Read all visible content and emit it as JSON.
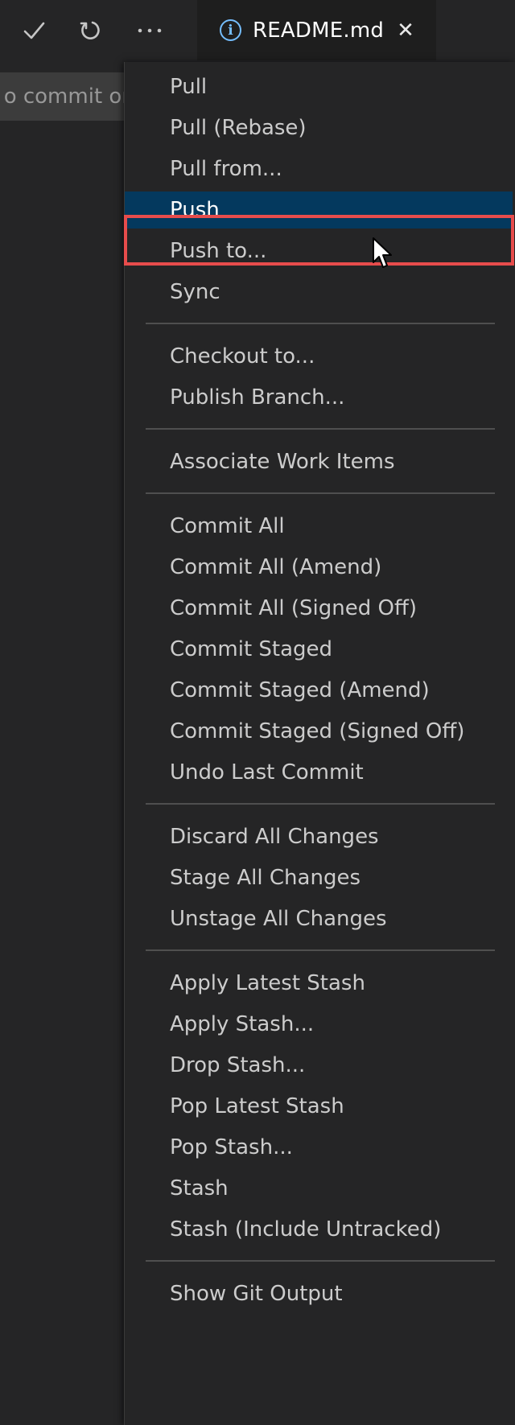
{
  "toolbar": {
    "commit_icon": "checkmark-icon",
    "refresh_icon": "refresh-icon",
    "more_icon": "ellipsis-icon",
    "more_label": "···"
  },
  "tab": {
    "icon": "info-icon",
    "icon_glyph": "i",
    "label": "README.md",
    "close_glyph": "✕"
  },
  "commit_input": {
    "text": "o commit or"
  },
  "menu": {
    "groups": [
      [
        "Pull",
        "Pull (Rebase)",
        "Pull from...",
        "Push",
        "Push to...",
        "Sync"
      ],
      [
        "Checkout to...",
        "Publish Branch..."
      ],
      [
        "Associate Work Items"
      ],
      [
        "Commit All",
        "Commit All (Amend)",
        "Commit All (Signed Off)",
        "Commit Staged",
        "Commit Staged (Amend)",
        "Commit Staged (Signed Off)",
        "Undo Last Commit"
      ],
      [
        "Discard All Changes",
        "Stage All Changes",
        "Unstage All Changes"
      ],
      [
        "Apply Latest Stash",
        "Apply Stash...",
        "Drop Stash...",
        "Pop Latest Stash",
        "Pop Stash...",
        "Stash",
        "Stash (Include Untracked)"
      ],
      [
        "Show Git Output"
      ]
    ],
    "active_item": "Push"
  },
  "colors": {
    "background": "#252526",
    "active_item": "#04395e",
    "highlight_border": "#e74c4c",
    "separator": "#4f4f4f",
    "text": "#cccccc",
    "info_icon": "#75beff"
  }
}
